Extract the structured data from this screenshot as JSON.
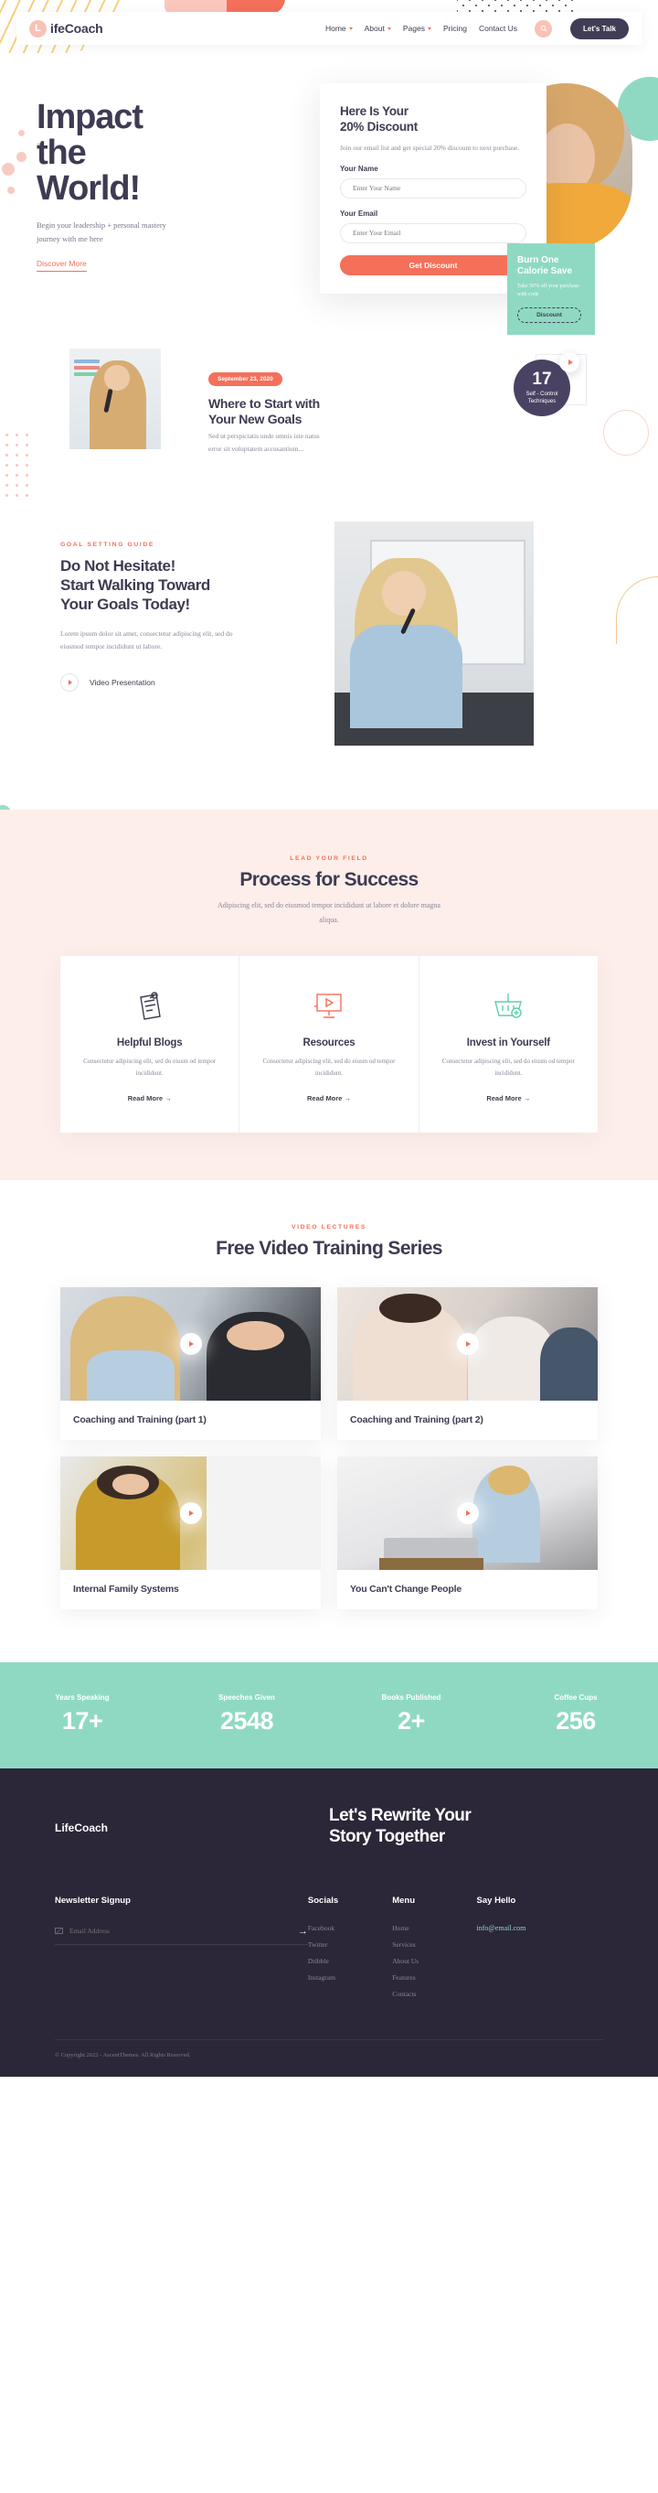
{
  "header": {
    "brand_initial": "L",
    "brand_name": "ifeCoach",
    "nav": [
      {
        "label": "Home",
        "has_caret": true
      },
      {
        "label": "About",
        "has_caret": true
      },
      {
        "label": "Pages",
        "has_caret": true
      },
      {
        "label": "Pricing",
        "has_caret": false
      },
      {
        "label": "Contact Us",
        "has_caret": false
      }
    ],
    "search_icon": "search-icon",
    "cta_label": "Let's Talk"
  },
  "hero": {
    "title_line1": "Impact",
    "title_line2": "the",
    "title_line3": "World!",
    "subtitle": "Begin your leadership + personal mastery journey with me here",
    "link_label": "Discover More",
    "discount": {
      "title_line1": "Here Is Your",
      "title_line2": "20% Discount",
      "description": "Join our email list and get special 20% discount to next purchase.",
      "name_label": "Your Name",
      "name_placeholder": "Enter Your Name",
      "name_value": "",
      "email_label": "Your Email",
      "email_placeholder": "Enter Your Email",
      "email_value": "",
      "submit_label": "Get Discount"
    },
    "promo": {
      "title_line1": "Burn One",
      "title_line2": "Calorie Save",
      "description": "Take 50% off your purchase with code",
      "code_label": "Discount"
    }
  },
  "post": {
    "date": "September 23, 2020",
    "title_line1": "Where to Start with",
    "title_line2": "Your New Goals",
    "excerpt_line1": "Sed ut perspiciatis unde omnis iste natus",
    "excerpt_line2": "error sit voluptatem accusantium...",
    "badge_number": "17",
    "badge_text_line1": "Self - Control",
    "badge_text_line2": "Techniques"
  },
  "goal": {
    "eyebrow": "GOAL SETTING GUIDE",
    "title_line1": "Do Not Hesitate!",
    "title_line2": "Start Walking Toward",
    "title_line3": "Your Goals Today!",
    "description": "Lorem ipsum dolor sit amet, consectetur adipiscing elit, sed do eiusmod tempor incididunt ut labore.",
    "video_label": "Video Presentation"
  },
  "process": {
    "eyebrow": "LEAD YOUR FIELD",
    "title": "Process for Success",
    "description": "Adipiscing elit, sed do eiusmod tempor incididunt ut labore et dolore magna aliqua.",
    "cards": [
      {
        "icon": "notepad-icon",
        "title": "Helpful Blogs",
        "description": "Consectetur adipiscing elit, sed do eiusm od tempor incididunt.",
        "link_label": "Read More  →"
      },
      {
        "icon": "video-monitor-icon",
        "title": "Resources",
        "description": "Consectetur adipiscing elit, sed do eiusm od tempor incididunt.",
        "link_label": "Read More  →"
      },
      {
        "icon": "basket-plus-icon",
        "title": "Invest in Yourself",
        "description": "Consectetur adipiscing elit, sed do eiusm od tempor incididunt.",
        "link_label": "Read More  →"
      }
    ]
  },
  "series": {
    "eyebrow": "VIDEO LECTURES",
    "title": "Free Video Training Series",
    "videos": [
      {
        "title": "Coaching and Training (part 1)"
      },
      {
        "title": "Coaching and Training (part 2)"
      },
      {
        "title": "Internal Family Systems"
      },
      {
        "title": "You Can't Change People"
      }
    ]
  },
  "stats": [
    {
      "label": "Years Speaking",
      "value": "17+"
    },
    {
      "label": "Speeches Given",
      "value": "2548"
    },
    {
      "label": "Books Published",
      "value": "2+"
    },
    {
      "label": "Coffee Cups",
      "value": "256"
    }
  ],
  "footer": {
    "brand": "LifeCoach",
    "headline_line1": "Let's Rewrite Your",
    "headline_line2": "Story Together",
    "newsletter_heading": "Newsletter Signup",
    "newsletter_placeholder": "Email Address",
    "newsletter_value": "",
    "submit_arrow": "→",
    "socials_heading": "Socials",
    "socials": [
      "Facebook",
      "Twitter",
      "Dribble",
      "Instagram"
    ],
    "menu_heading": "Menu",
    "menu": [
      "Home",
      "Services",
      "About Us",
      "Features",
      "Contacts"
    ],
    "hello_heading": "Say Hello",
    "email": "info@email.com",
    "copyright": "© Copyright 2022 - AscentThemes. All Rights Reserved."
  },
  "colors": {
    "coral": "#f4705a",
    "pink": "#f8c2b6",
    "mint": "#8fd9c2",
    "dark": "#3f3b52",
    "footer_bg": "#2b2738",
    "blush_bg": "#fdeeea"
  }
}
